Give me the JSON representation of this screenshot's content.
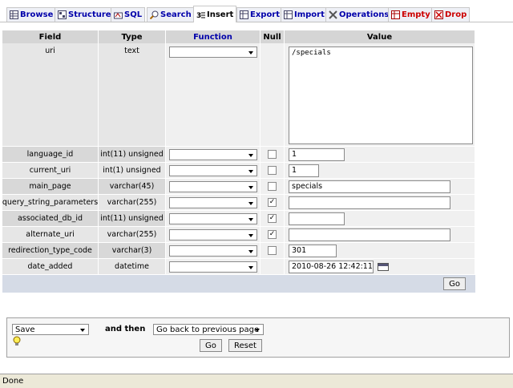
{
  "tabs": [
    {
      "label": "Browse",
      "icon": "table-icon",
      "active": false
    },
    {
      "label": "Structure",
      "icon": "structure-icon",
      "active": false
    },
    {
      "label": "SQL",
      "icon": "sql-icon",
      "active": false
    },
    {
      "label": "Search",
      "icon": "search-icon",
      "active": false
    },
    {
      "label": "Insert",
      "icon": "insert-icon",
      "active": true
    },
    {
      "label": "Export",
      "icon": "export-icon",
      "active": false
    },
    {
      "label": "Import",
      "icon": "import-icon",
      "active": false
    },
    {
      "label": "Operations",
      "icon": "wrench-icon",
      "active": false
    },
    {
      "label": "Empty",
      "icon": "empty-icon",
      "active": false
    },
    {
      "label": "Drop",
      "icon": "drop-icon",
      "active": false
    }
  ],
  "table": {
    "headers": {
      "field": "Field",
      "type": "Type",
      "function": "Function",
      "null": "Null",
      "value": "Value"
    },
    "rows": [
      {
        "field": "uri",
        "type": "text",
        "null": null,
        "value": "/specials"
      },
      {
        "field": "language_id",
        "type": "int(11) unsigned",
        "null": false,
        "value": "1"
      },
      {
        "field": "current_uri",
        "type": "int(1) unsigned",
        "null": false,
        "value": "1"
      },
      {
        "field": "main_page",
        "type": "varchar(45)",
        "null": false,
        "value": "specials"
      },
      {
        "field": "query_string_parameters",
        "type": "varchar(255)",
        "null": true,
        "value": ""
      },
      {
        "field": "associated_db_id",
        "type": "int(11) unsigned",
        "null": true,
        "value": ""
      },
      {
        "field": "alternate_uri",
        "type": "varchar(255)",
        "null": true,
        "value": ""
      },
      {
        "field": "redirection_type_code",
        "type": "varchar(3)",
        "null": false,
        "value": "301"
      },
      {
        "field": "date_added",
        "type": "datetime",
        "null": null,
        "value": "2010-08-26 12:42:11"
      }
    ],
    "go_label": "Go"
  },
  "actions": {
    "save_option": "Save",
    "and_then_label": "and then",
    "after_option": "Go back to previous page",
    "go_label": "Go",
    "reset_label": "Reset"
  },
  "status": "Done",
  "colors": {
    "link": "#0000aa",
    "danger": "#cc0000",
    "header_bg": "#d5d5d5",
    "footer_bg": "#d5dbe6"
  }
}
